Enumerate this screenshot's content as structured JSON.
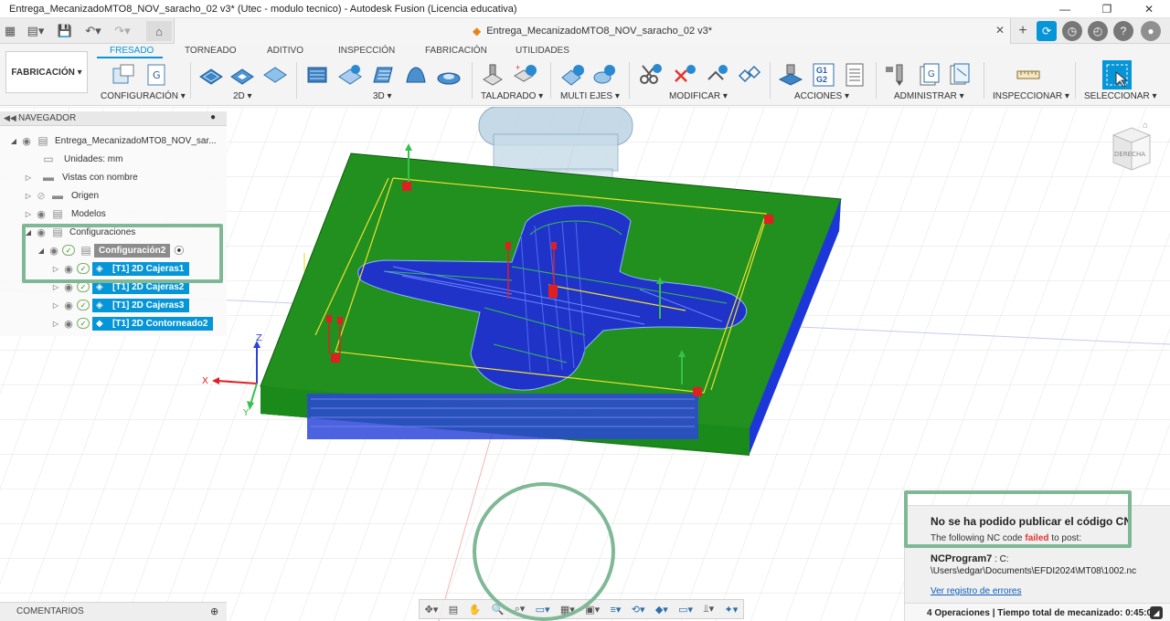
{
  "window": {
    "title": "Entrega_MecanizadoMTO8_NOV_saracho_02 v3* (Utec - modulo tecnico) - Autodesk Fusion (Licencia educativa)",
    "controls": [
      "—",
      "❐",
      "✕"
    ]
  },
  "document_tab": {
    "label": "Entrega_MecanizadoMTO8_NOV_saracho_02 v3*",
    "close": "✕"
  },
  "workspace": {
    "label": "FABRICACIÓN ▾"
  },
  "ribbon_tabs": [
    "FRESADO",
    "TORNEADO",
    "ADITIVO",
    "INSPECCIÓN",
    "FABRICACIÓN",
    "UTILIDADES"
  ],
  "ribbon_groups": [
    "CONFIGURACIÓN ▾",
    "2D ▾",
    "3D ▾",
    "TALADRADO ▾",
    "MULTI EJES ▾",
    "MODIFICAR ▾",
    "ACCIONES ▾",
    "ADMINISTRAR ▾",
    "INSPECCIONAR ▾",
    "SELECCIONAR ▾"
  ],
  "ribbon_icon_text": {
    "g1g2": "G1\nG2",
    "g": "G"
  },
  "browser": {
    "title": "NAVEGADOR",
    "root": "Entrega_MecanizadoMTO8_NOV_sar...",
    "units": "Unidades: mm",
    "named_views": "Vistas con nombre",
    "origin": "Origen",
    "models": "Modelos",
    "setups": "Configuraciones",
    "setup": "Configuración2",
    "operations": [
      "[T1] 2D Cajeras1",
      "[T1] 2D Cajeras2",
      "[T1] 2D Cajeras3",
      "[T1] 2D Contorneado2"
    ]
  },
  "comments": {
    "label": "COMENTARIOS"
  },
  "viewcube": {
    "label": "DERECHA"
  },
  "axes": {
    "x": "X",
    "y": "Y",
    "z": "Z"
  },
  "notification": {
    "title": "No se ha podido publicar el código CN",
    "sub_before": "The following NC code ",
    "sub_failed": "failed",
    "sub_after": " to post:",
    "program": "NCProgram7",
    "path_prefix": " : C:",
    "path": "\\Users\\edgar\\Documents\\EFDI2024\\MT08\\1002.nc",
    "link": "Ver registro de errores"
  },
  "status": {
    "text": "4 Operaciones | Tiempo total de mecanizado: 0:45:07"
  },
  "colors": {
    "accent": "#0696d7",
    "highlight": "#7fb895",
    "stock": "#1f8b1f",
    "error": "#e3342f"
  }
}
